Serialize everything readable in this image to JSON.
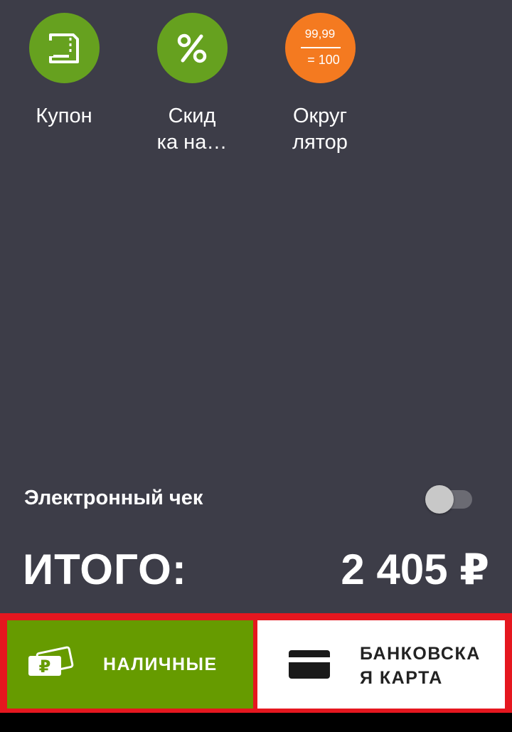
{
  "tiles": {
    "coupon": {
      "label": "Купон",
      "icon": "coupon-icon",
      "color": "#66a11f"
    },
    "discount": {
      "label": "Скид\nка на…",
      "icon": "percent-icon",
      "color": "#66a11f"
    },
    "rounder": {
      "label": "Округ\nлятор",
      "icon": "rounding-icon",
      "color": "#f47a20",
      "top_value": "99,99",
      "bottom_value": "= 100"
    }
  },
  "receipt": {
    "electronic_label": "Электронный чек",
    "electronic_enabled": false
  },
  "total": {
    "label": "ИТОГО:",
    "value": "2 405 ₽"
  },
  "payment": {
    "cash_label": "НАЛИЧНЫЕ",
    "card_label": "БАНКОВСКА\nЯ КАРТА",
    "cash_color": "#669b00",
    "highlight_color": "#e5171f"
  }
}
